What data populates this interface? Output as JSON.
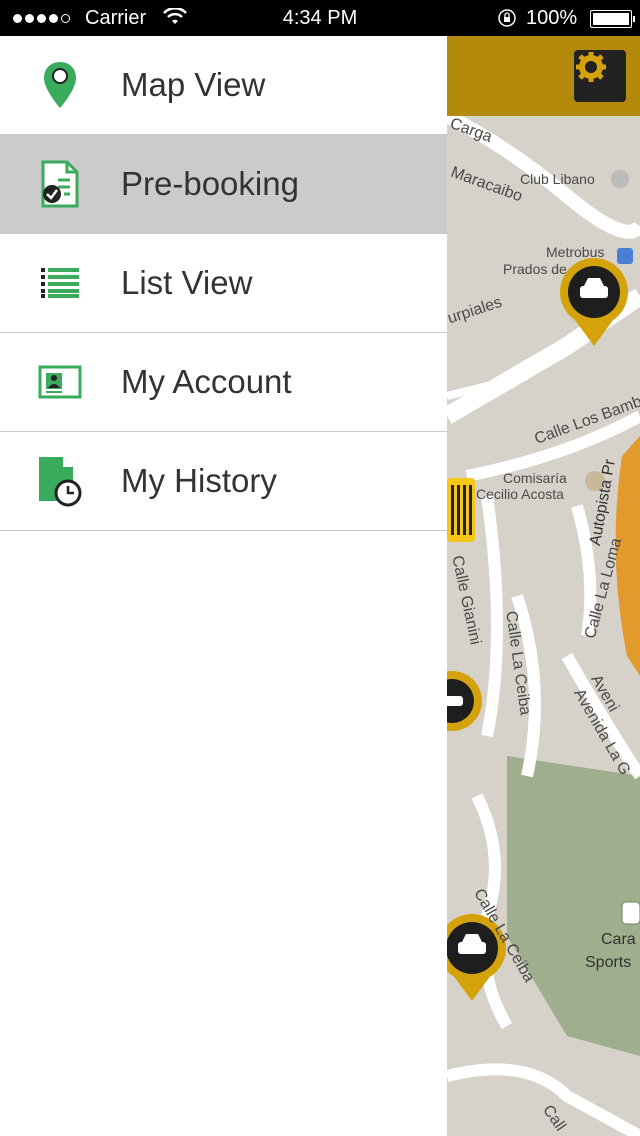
{
  "status_bar": {
    "carrier": "Carrier",
    "time": "4:34 PM",
    "battery": "100%"
  },
  "menu": {
    "items": [
      {
        "label": "Map View",
        "icon": "map-pin-icon",
        "active": false
      },
      {
        "label": "Pre-booking",
        "icon": "document-check-icon",
        "active": true
      },
      {
        "label": "List View",
        "icon": "list-icon",
        "active": false
      },
      {
        "label": "My Account",
        "icon": "id-card-icon",
        "active": false
      },
      {
        "label": "My History",
        "icon": "document-clock-icon",
        "active": false
      }
    ]
  },
  "map": {
    "labels": [
      "Carga",
      "Maracaibo",
      "Club Libano",
      "Metrobus",
      "Prados de",
      "urpiales",
      "Calle Los Bamb",
      "Comisaría",
      "Cecilio Acosta",
      "Autopista Pr",
      "Calle Gianini",
      "Calle La Ceiba",
      "Calle La Loma",
      "Aveni",
      "Avenida La G",
      "Calle La Ceiba",
      "Cara",
      "Sports",
      "Call"
    ]
  },
  "colors": {
    "accent_green": "#3aaa5c",
    "header_gold": "#b48a0a",
    "marker_yellow": "#f5c518",
    "active_row": "#cbcbcb"
  }
}
